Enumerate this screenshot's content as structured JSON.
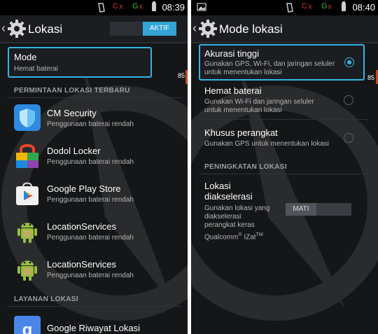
{
  "left": {
    "status": {
      "time": "08:39",
      "c": "C",
      "x": "X",
      "g": "G"
    },
    "title": "Lokasi",
    "toggle_label": "AKTIF",
    "mode": {
      "title": "Mode",
      "subtitle": "Hemat baterai"
    },
    "side_number": "85",
    "section_recent": "PERMINTAAN LOKASI TERBARU",
    "apps": [
      {
        "name": "CM Security",
        "sub": "Penggunaan baterai rendah"
      },
      {
        "name": "Dodol Locker",
        "sub": "Penggunaan baterai rendah"
      },
      {
        "name": "Google Play Store",
        "sub": "Penggunaan baterai rendah"
      },
      {
        "name": "LocationServices",
        "sub": "Penggunaan baterai rendah"
      },
      {
        "name": "LocationServices",
        "sub": "Penggunaan baterai rendah"
      }
    ],
    "section_services": "LAYANAN LOKASI",
    "service": {
      "name": "Google Riwayat Lokasi"
    }
  },
  "right": {
    "status": {
      "time": "08:40",
      "c": "C",
      "x": "X",
      "g": "G"
    },
    "title": "Mode lokasi",
    "side_number": "85",
    "modes": [
      {
        "title": "Akurasi tinggi",
        "sub1": "Gunakan GPS, Wi-Fi, dan jaringan seluler",
        "sub2": "untuk menentukan lokasi",
        "selected": true
      },
      {
        "title": "Hemat baterai",
        "sub1": "Gunakan Wi-Fi dan jaringan seluler",
        "sub2": "untuk menentukan lokasi",
        "selected": false
      },
      {
        "title": "Khusus perangkat",
        "sub1": "Gunakan GPS untuk menentukan lokasi",
        "sub2": "",
        "selected": false
      }
    ],
    "section_enhance": "PENINGKATAN LOKASI",
    "enhance": {
      "title1": "Lokasi",
      "title2": "diakselerasi",
      "sub1": "Gunakan lokasi yang",
      "sub2": "diakselerasi",
      "sub3": "perangkat keras",
      "brand": "Qualcomm",
      "reg": "®",
      "brand2": "IZat",
      "tm": "TM",
      "toggle_label": "MATI"
    }
  },
  "colors": {
    "accent": "#33b5e5",
    "background": "#141618",
    "toggle_on": "#33a4d6",
    "edge": "#c8451a"
  }
}
